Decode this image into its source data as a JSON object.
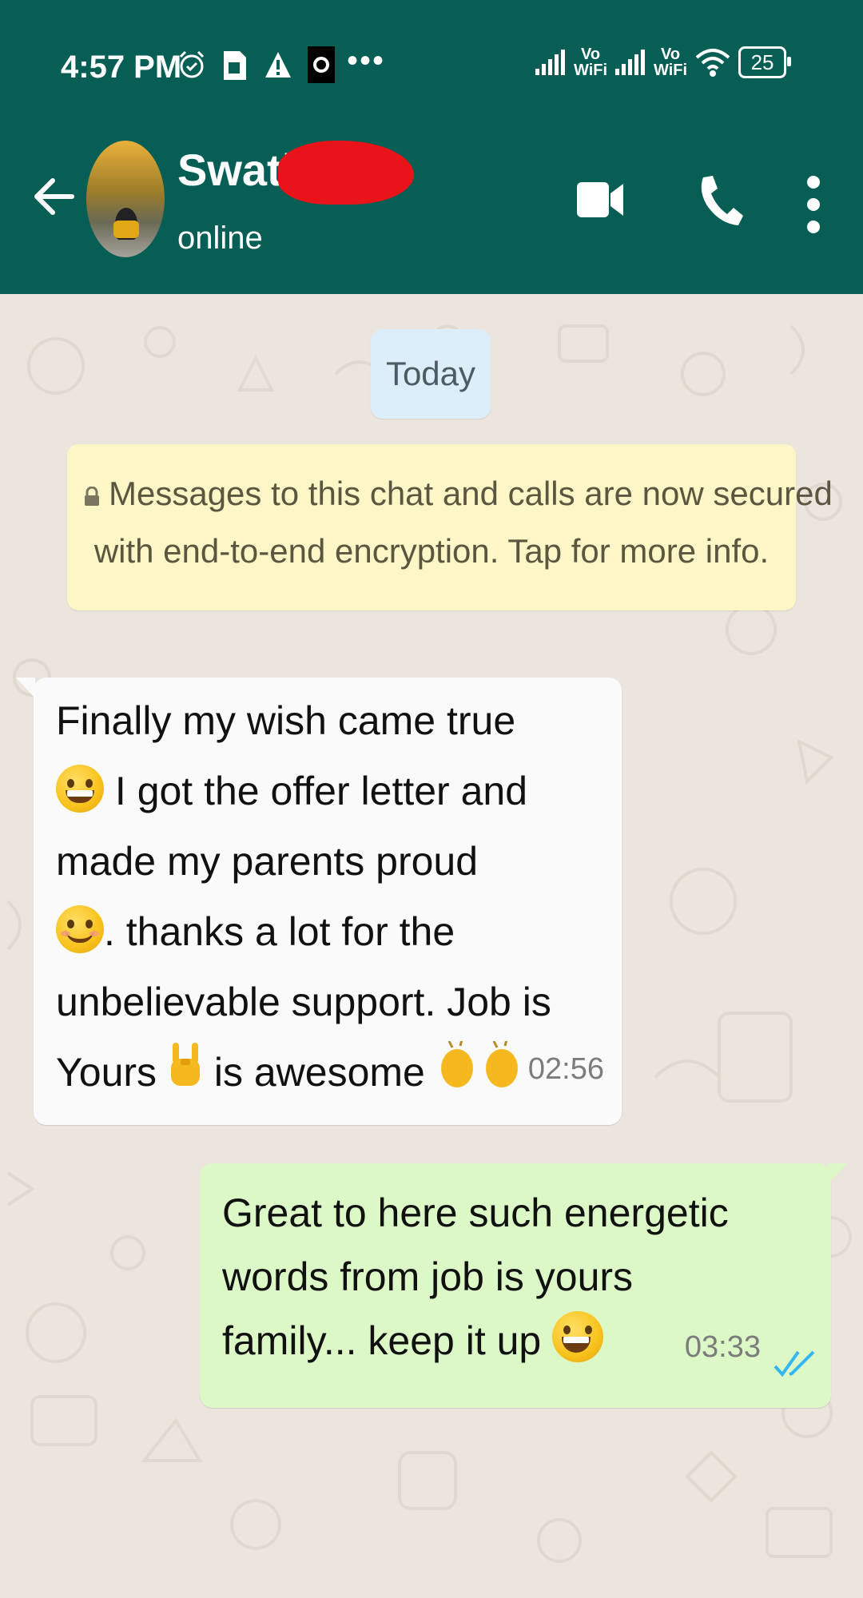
{
  "status_bar": {
    "time": "4:57 PM",
    "more": "•••",
    "vowifi_1": "Vo\nWiFi",
    "vowifi_2": "Vo\nWiFi",
    "battery": "25"
  },
  "header": {
    "contact_name": "Swati",
    "presence": "online"
  },
  "chat": {
    "date_chip": "Today",
    "encryption_notice": [
      "Messages to this chat and calls are now secured",
      "with end-to-end encryption. Tap for more info."
    ],
    "incoming": {
      "lines": {
        "l1": "Finally my wish came true",
        "l2": "I got the offer letter and",
        "l3": "made my parents proud",
        "l4": ". thanks a lot for the",
        "l5": "unbelievable support. Job is",
        "l6a": "Yours",
        "l6b": "is awesome"
      },
      "time": "02:56"
    },
    "outgoing": {
      "lines": {
        "l1": "Great to here such energetic",
        "l2": "words from  job is yours",
        "l3": "family... keep it up"
      },
      "time": "03:33",
      "status_icon": "double-check-read-icon"
    }
  },
  "colors": {
    "header": "#075e54",
    "chat_bg": "#ece5dd",
    "outgoing_bubble": "#dcf8c6",
    "incoming_bubble": "#fafafa",
    "notice_bg": "#fdf6c6",
    "date_chip_bg": "#dbeef9",
    "read_ticks": "#34b7f1"
  }
}
